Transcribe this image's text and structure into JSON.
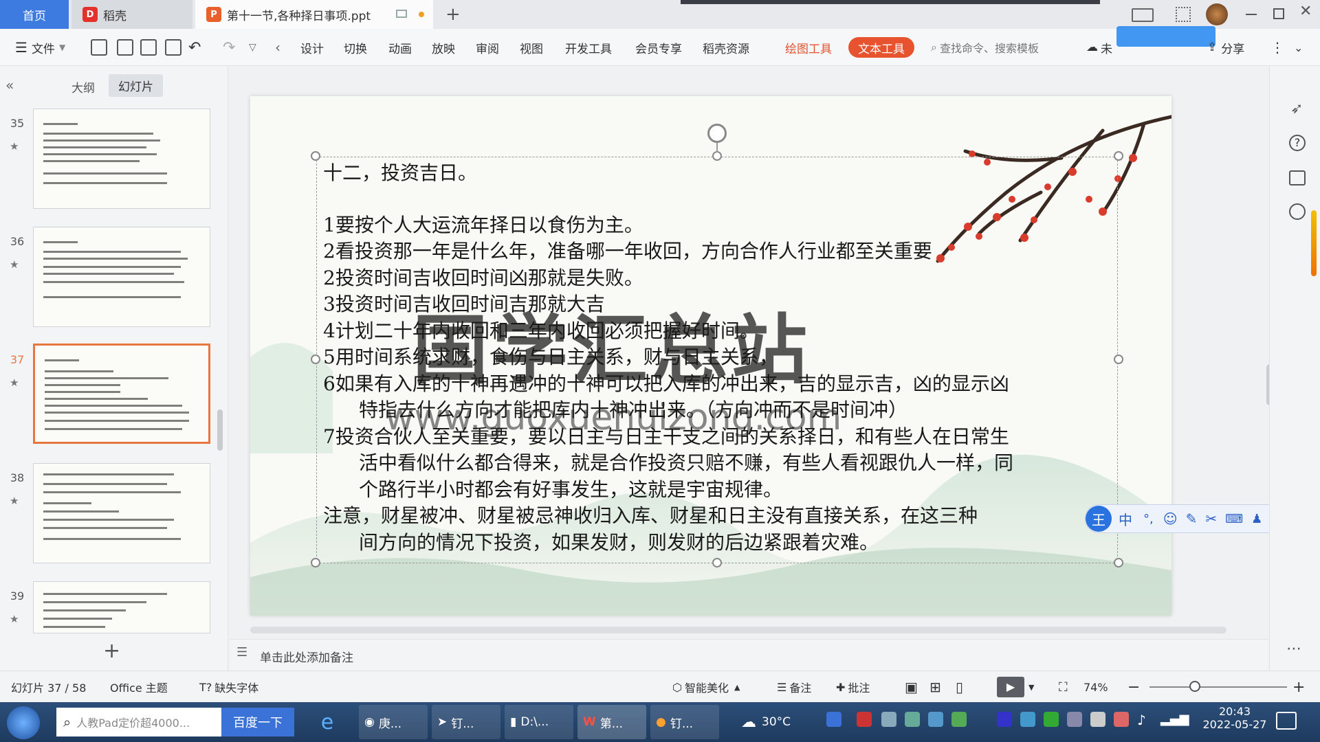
{
  "tabs": {
    "home": "首页",
    "daoke": "稻壳",
    "document": "第十一节,各种择日事项.ppt",
    "new_tab": "+"
  },
  "toolbar": {
    "file": "文件",
    "menus": [
      "设计",
      "切换",
      "动画",
      "放映",
      "审阅",
      "视图",
      "开发工具",
      "会员专享",
      "稻壳资源"
    ],
    "draw_tool": "绘图工具",
    "text_tool": "文本工具",
    "search_placeholder": "查找命令、搜索模板",
    "cloud": "未",
    "share": "分享"
  },
  "sidebar": {
    "outline_tab": "大纲",
    "slides_tab": "幻灯片",
    "slide_numbers": [
      "35",
      "36",
      "37",
      "38",
      "39"
    ],
    "selected": "37",
    "add": "+"
  },
  "slide": {
    "title": "十二，投资吉日。",
    "lines": [
      "1要按个人大运流年择日以食伤为主。",
      "2看投资那一年是什么年，准备哪一年收回，方向合作人行业都至关重要",
      "2投资时间吉收回时间凶那就是失败。",
      "3投资时间吉收回时间吉那就大吉",
      "4计划二十年内收回和三年内收回必须把握好时间。",
      "5用时间系统求财，食伤与日主关系，财与日主关系，",
      "6如果有入库的十神再遇冲的十神可以把入库的冲出来，吉的显示吉，凶的显示凶",
      "特指去什么方向才能把库内十神冲出来。（方向冲而不是时间冲）",
      "7投资合伙人至关重要，要以日主与日主干支之间的关系择日，和有些人在日常生",
      "活中看似什么都合得来，就是合作投资只赔不赚，有些人看视跟仇人一样，同",
      "个路行半小时都会有好事发生，这就是宇宙规律。",
      "注意，财星被冲、财星被忌神收归入库、财星和日主没有直接关系，在这三种",
      "间方向的情况下投资，如果发财，则发财的后边紧跟着灾难。"
    ],
    "watermark": "国学汇总站",
    "watermark_url": "www.guoxuehuizong.com"
  },
  "notes": {
    "placeholder": "单击此处添加备注"
  },
  "ime": {
    "label": "中"
  },
  "status": {
    "slide_counter": "幻灯片 37 / 58",
    "theme": "Office 主题",
    "missing_font": "缺失字体",
    "beautify": "智能美化",
    "notes": "备注",
    "comments": "批注",
    "zoom": "74%"
  },
  "taskbar": {
    "search_placeholder": "人教Pad定价超4000...",
    "baidu": "百度一下",
    "items": [
      "庚...",
      "钉...",
      "D:\\...",
      "第...",
      "钉..."
    ],
    "weather": "30°C",
    "time": "20:43",
    "date": "2022-05-27"
  }
}
